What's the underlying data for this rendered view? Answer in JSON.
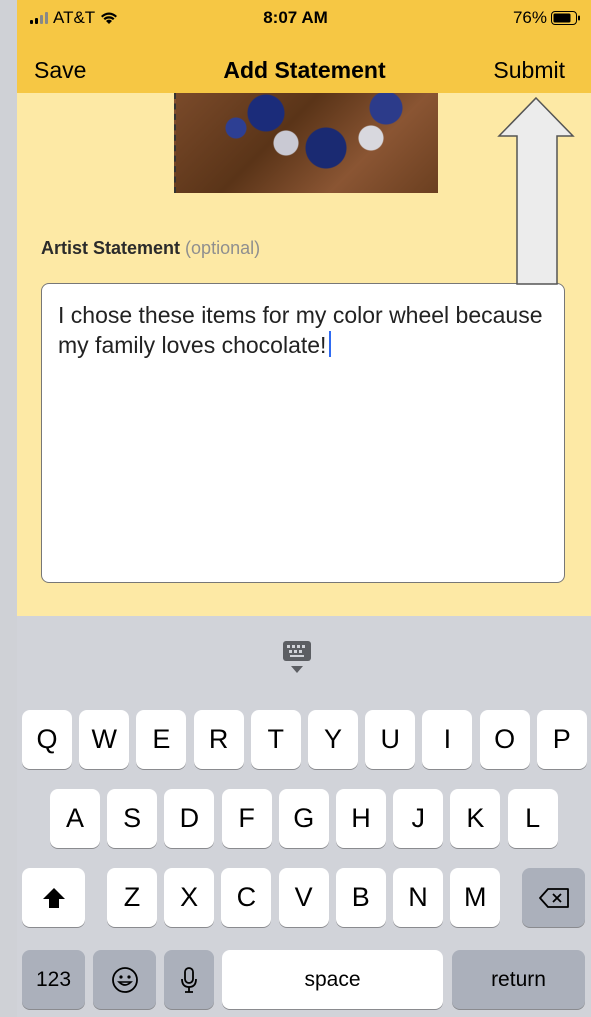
{
  "status": {
    "carrier": "AT&T",
    "time": "8:07 AM",
    "battery": "76%"
  },
  "nav": {
    "save": "Save",
    "title": "Add Statement",
    "submit": "Submit"
  },
  "statement": {
    "label": "Artist Statement",
    "optional": "(optional)",
    "text": "I chose these items for my color wheel because my family loves chocolate!"
  },
  "keyboard": {
    "row1": [
      "Q",
      "W",
      "E",
      "R",
      "T",
      "Y",
      "U",
      "I",
      "O",
      "P"
    ],
    "row2": [
      "A",
      "S",
      "D",
      "F",
      "G",
      "H",
      "J",
      "K",
      "L"
    ],
    "row3": [
      "Z",
      "X",
      "C",
      "V",
      "B",
      "N",
      "M"
    ],
    "numbers": "123",
    "space": "space",
    "return": "return"
  },
  "icons": {
    "shift": "shift-icon",
    "delete": "backspace-icon",
    "emoji": "emoji-icon",
    "mic": "microphone-icon",
    "dismiss": "keyboard-dismiss-icon",
    "wifi": "wifi-icon"
  },
  "colors": {
    "header": "#f6c744",
    "content": "#fde9a5",
    "keyboard": "#d1d3d9",
    "caret": "#2f6bf2"
  }
}
